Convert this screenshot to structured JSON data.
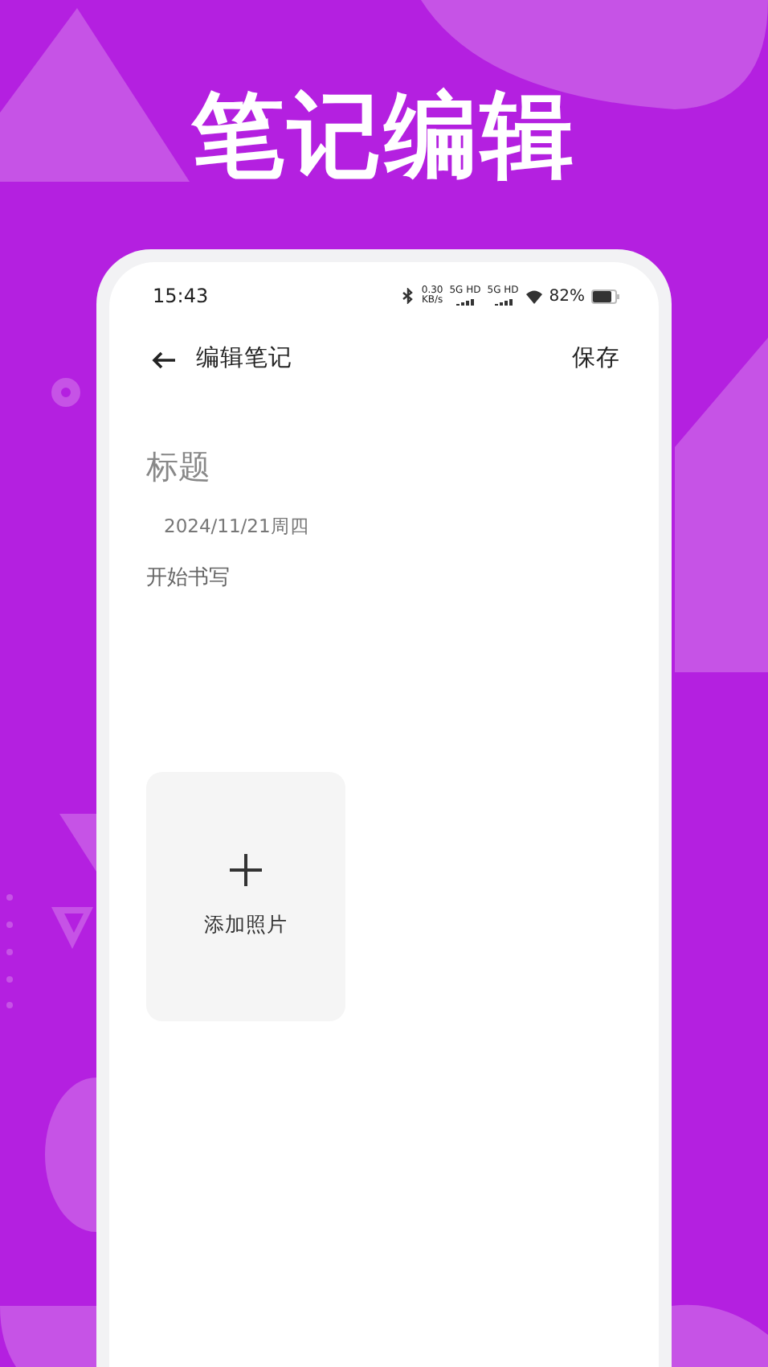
{
  "headline": "笔记编辑",
  "status_bar": {
    "time": "15:43",
    "speed_value": "0.30",
    "speed_unit": "KB/s",
    "networks": [
      "5G HD",
      "5G HD"
    ],
    "battery": "82%"
  },
  "header": {
    "title": "编辑笔记",
    "action": "保存"
  },
  "note": {
    "title_placeholder": "标题",
    "date": "2024/11/21周四",
    "body_placeholder": "开始书写"
  },
  "add_photo": {
    "label": "添加照片"
  }
}
